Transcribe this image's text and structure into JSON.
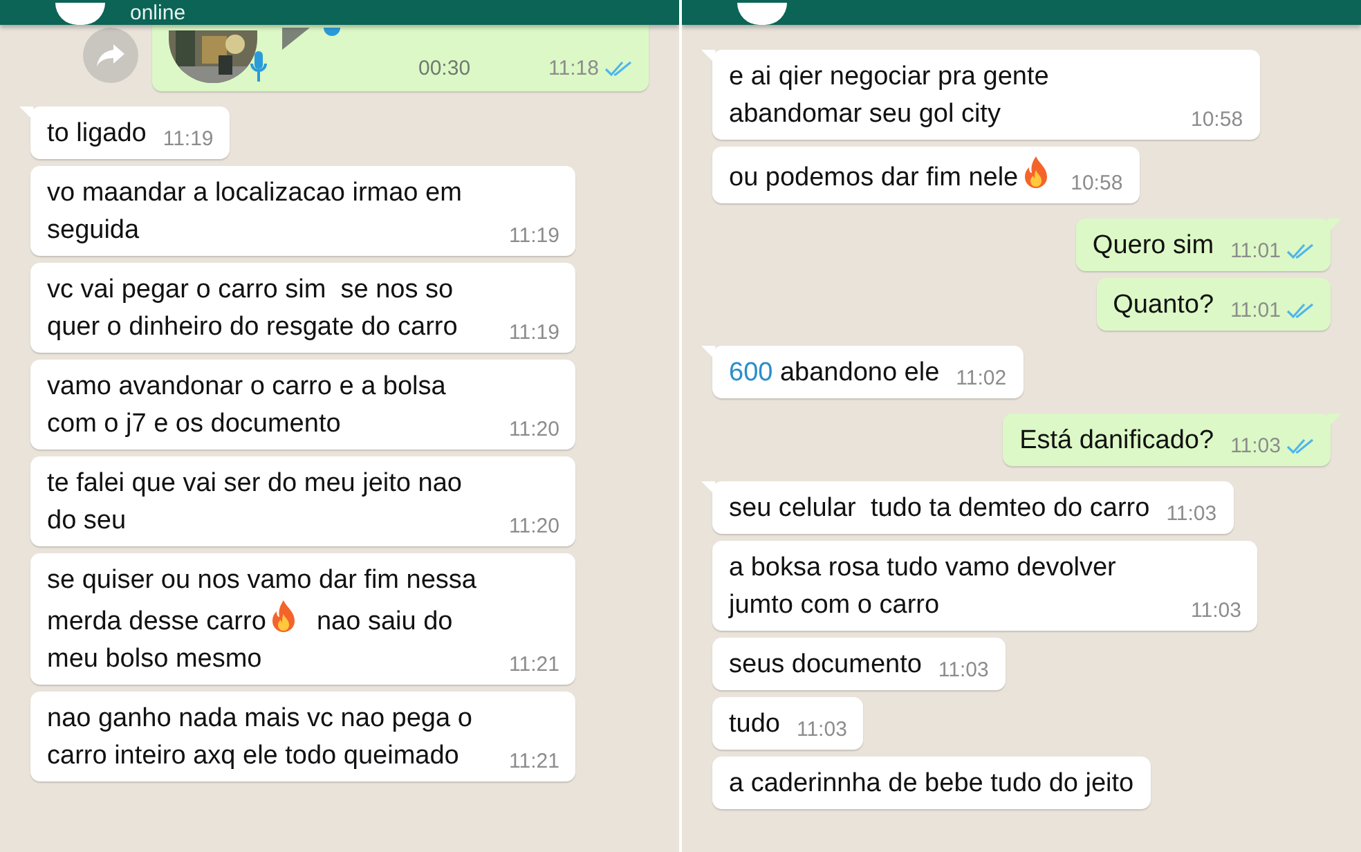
{
  "panels": [
    {
      "header": {
        "status": "online"
      },
      "messages": [
        {
          "kind": "voice",
          "sent": true,
          "duration": "00:30",
          "time": "11:18",
          "read": true
        },
        {
          "kind": "text",
          "sent": false,
          "segments": [
            {
              "kind": "text",
              "text": "to ligado"
            }
          ],
          "time": "11:19"
        },
        {
          "kind": "text",
          "sent": false,
          "segments": [
            {
              "kind": "text",
              "text": "vo maandar a localizacao irmao em seguida"
            }
          ],
          "time": "11:19"
        },
        {
          "kind": "text",
          "sent": false,
          "segments": [
            {
              "kind": "text",
              "text": "vc vai pegar o carro sim  se nos so quer o dinheiro do resgate do carro"
            }
          ],
          "time": "11:19"
        },
        {
          "kind": "text",
          "sent": false,
          "segments": [
            {
              "kind": "text",
              "text": "vamo avandonar o carro e a bolsa com o j7 e os documento"
            }
          ],
          "time": "11:20"
        },
        {
          "kind": "text",
          "sent": false,
          "segments": [
            {
              "kind": "text",
              "text": "te falei que vai ser do meu jeito nao do seu"
            }
          ],
          "time": "11:20"
        },
        {
          "kind": "text",
          "sent": false,
          "segments": [
            {
              "kind": "text",
              "text": "se quiser ou nos vamo dar fim nessa merda desse carro"
            },
            {
              "kind": "flame"
            },
            {
              "kind": "text",
              "text": "  nao saiu do meu bolso mesmo"
            }
          ],
          "time": "11:21"
        },
        {
          "kind": "text",
          "sent": false,
          "segments": [
            {
              "kind": "text",
              "text": "nao ganho nada mais vc nao pega o carro inteiro axq ele todo queimado"
            }
          ],
          "time": "11:21"
        }
      ]
    },
    {
      "messages": [
        {
          "kind": "text",
          "sent": false,
          "segments": [
            {
              "kind": "text",
              "text": "e ai qier negociar pra gente abandomar seu gol city"
            }
          ],
          "time": "10:58"
        },
        {
          "kind": "text",
          "sent": false,
          "segments": [
            {
              "kind": "text",
              "text": "ou podemos dar fim nele"
            },
            {
              "kind": "flame"
            }
          ],
          "time": "10:58"
        },
        {
          "kind": "text",
          "sent": true,
          "segments": [
            {
              "kind": "text",
              "text": "Quero sim"
            }
          ],
          "time": "11:01",
          "read": true
        },
        {
          "kind": "text",
          "sent": true,
          "segments": [
            {
              "kind": "text",
              "text": "Quanto?"
            }
          ],
          "time": "11:01",
          "read": true
        },
        {
          "kind": "text",
          "sent": false,
          "segments": [
            {
              "kind": "link",
              "text": "600"
            },
            {
              "kind": "text",
              "text": " abandono ele"
            }
          ],
          "time": "11:02"
        },
        {
          "kind": "text",
          "sent": true,
          "segments": [
            {
              "kind": "text",
              "text": "Está danificado?"
            }
          ],
          "time": "11:03",
          "read": true
        },
        {
          "kind": "text",
          "sent": false,
          "segments": [
            {
              "kind": "text",
              "text": "seu celular  tudo ta demteo do carro"
            }
          ],
          "time": "11:03"
        },
        {
          "kind": "text",
          "sent": false,
          "segments": [
            {
              "kind": "text",
              "text": "a boksa rosa tudo vamo devolver jumto com o carro"
            }
          ],
          "time": "11:03"
        },
        {
          "kind": "text",
          "sent": false,
          "segments": [
            {
              "kind": "text",
              "text": "seus documento"
            }
          ],
          "time": "11:03"
        },
        {
          "kind": "text",
          "sent": false,
          "segments": [
            {
              "kind": "text",
              "text": "tudo"
            }
          ],
          "time": "11:03"
        },
        {
          "kind": "text",
          "sent": false,
          "segments": [
            {
              "kind": "text",
              "text": "a caderinnha de bebe tudo do jeito"
            }
          ]
        }
      ]
    }
  ]
}
